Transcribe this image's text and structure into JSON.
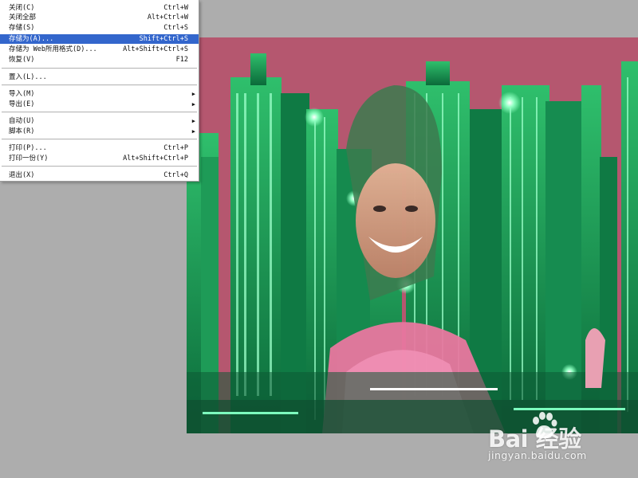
{
  "file_menu": {
    "items": [
      {
        "label": "关闭(C)",
        "shortcut": "Ctrl+W",
        "submenu": false,
        "highlighted": false
      },
      {
        "label": "关闭全部",
        "shortcut": "Alt+Ctrl+W",
        "submenu": false,
        "highlighted": false
      },
      {
        "label": "存储(S)",
        "shortcut": "Ctrl+S",
        "submenu": false,
        "highlighted": false
      },
      {
        "label": "存储为(A)...",
        "shortcut": "Shift+Ctrl+S",
        "submenu": false,
        "highlighted": true
      },
      {
        "label": "存储为 Web所用格式(D)...",
        "shortcut": "Alt+Shift+Ctrl+S",
        "submenu": false,
        "highlighted": false
      },
      {
        "label": "恢复(V)",
        "shortcut": "F12",
        "submenu": false,
        "highlighted": false
      },
      {
        "label": "置入(L)...",
        "shortcut": "",
        "submenu": false,
        "highlighted": false
      },
      {
        "label": "导入(M)",
        "shortcut": "",
        "submenu": true,
        "highlighted": false
      },
      {
        "label": "导出(E)",
        "shortcut": "",
        "submenu": true,
        "highlighted": false
      },
      {
        "label": "自动(U)",
        "shortcut": "",
        "submenu": true,
        "highlighted": false
      },
      {
        "label": "脚本(R)",
        "shortcut": "",
        "submenu": true,
        "highlighted": false
      },
      {
        "label": "打印(P)...",
        "shortcut": "Ctrl+P",
        "submenu": false,
        "highlighted": false
      },
      {
        "label": "打印一份(Y)",
        "shortcut": "Alt+Shift+Ctrl+P",
        "submenu": false,
        "highlighted": false
      },
      {
        "label": "退出(X)",
        "shortcut": "Ctrl+Q",
        "submenu": false,
        "highlighted": false
      }
    ],
    "highlight_color": "#3366cc"
  },
  "canvas": {
    "sky_color": "#b5576f",
    "city_color": "#17a85a",
    "light_color": "#4dff9a"
  },
  "watermark": {
    "logo_text": "Bai  经验",
    "url": "jingyan.baidu.com"
  }
}
